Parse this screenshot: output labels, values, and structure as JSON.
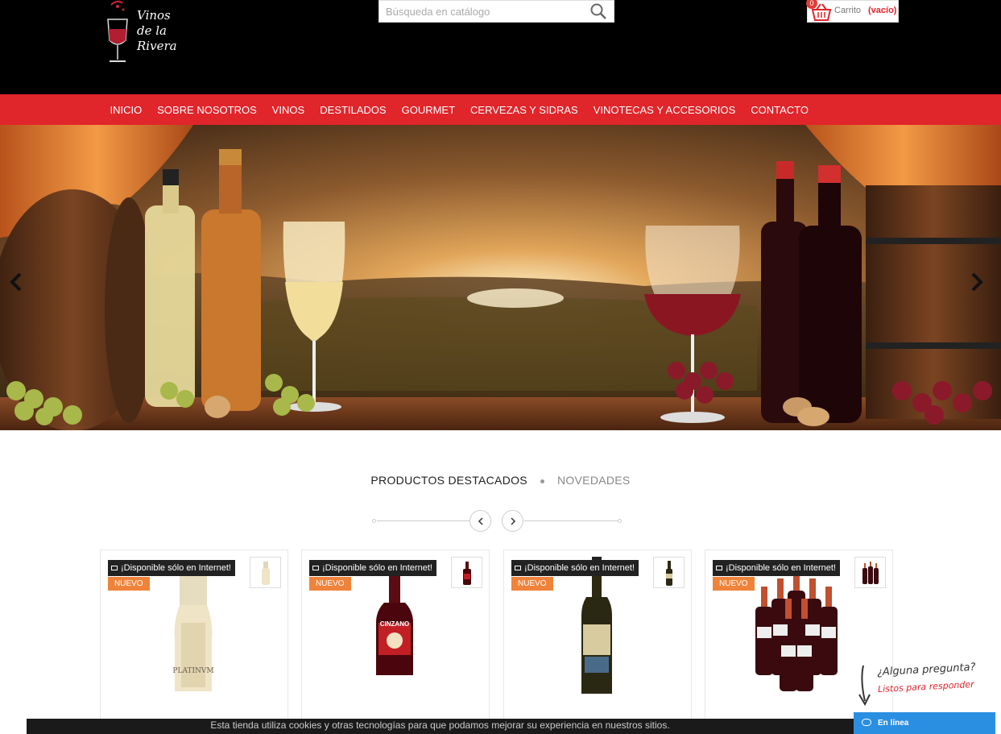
{
  "header": {
    "logo_text": [
      "Vinos",
      "de la",
      "Rivera"
    ],
    "search_placeholder": "Búsqueda en catálogo",
    "cart": {
      "count": "0",
      "label": "Carrito",
      "status": "(vacío)"
    }
  },
  "nav": {
    "items": [
      "INICIO",
      "SOBRE NOSOTROS",
      "VINOS",
      "DESTILADOS",
      "GOURMET",
      "CERVEZAS Y SIDRAS",
      "VINOTECAS Y ACCESORIOS",
      "CONTACTO"
    ]
  },
  "tabs": {
    "active": "PRODUCTOS DESTACADOS",
    "other": "NOVEDADES"
  },
  "products": [
    {
      "badge_internet": "¡Disponible sólo en Internet!",
      "badge_new": "NUEVO",
      "label_text": "PLATINVM"
    },
    {
      "badge_internet": "¡Disponible sólo en Internet!",
      "badge_new": "NUEVO",
      "label_text": "CINZANO"
    },
    {
      "badge_internet": "¡Disponible sólo en Internet!",
      "badge_new": "NUEVO",
      "label_text": ""
    },
    {
      "badge_internet": "¡Disponible sólo en Internet!",
      "badge_new": "NUEVO",
      "label_text": ""
    }
  ],
  "chat": {
    "question": "¿Alguna pregunta?",
    "answer": "Listos para responder",
    "status": "En línea"
  },
  "cookie_text": "Esta tienda utiliza cookies y otras tecnologías para que podamos mejorar su experiencia en nuestros sitios.",
  "colors": {
    "brand_red": "#e0252b",
    "header_bg": "#000000",
    "new_badge": "#f0833a",
    "chat_blue": "#2a8fe0"
  }
}
